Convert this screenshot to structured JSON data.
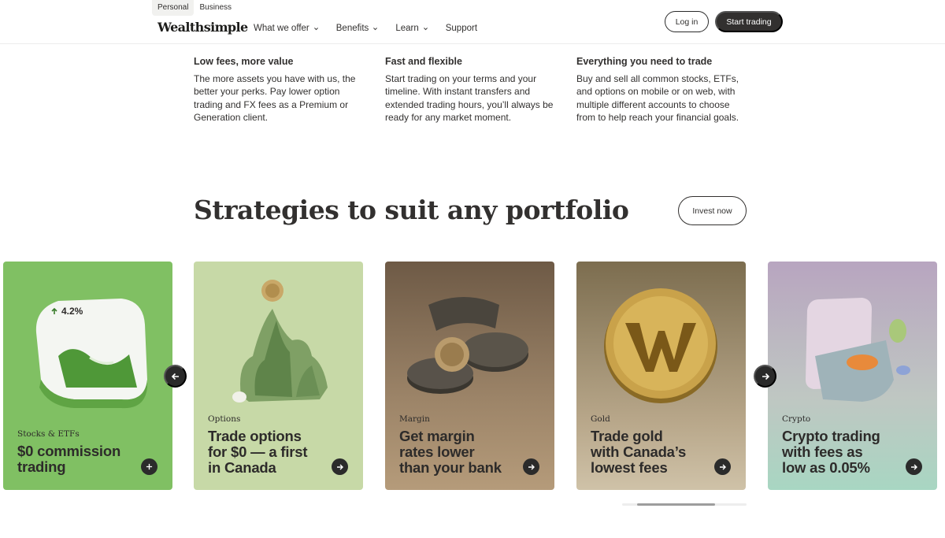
{
  "header": {
    "segments": [
      "Personal",
      "Business"
    ],
    "logo": "Wealthsimple",
    "nav": [
      {
        "label": "What we offer",
        "dropdown": true
      },
      {
        "label": "Benefits",
        "dropdown": true
      },
      {
        "label": "Learn",
        "dropdown": true
      },
      {
        "label": "Support",
        "dropdown": false
      }
    ],
    "login": "Log in",
    "start": "Start trading"
  },
  "features": [
    {
      "title": "Low fees, more value",
      "lines": [
        "The more assets you have with us, the",
        "better your perks. Pay lower option",
        "trading and FX fees as a Premium or",
        "Generation client."
      ]
    },
    {
      "title": "Fast and flexible",
      "lines": [
        "Start trading on your terms and your",
        "timeline. With instant transfers and",
        "extended trading hours, you’ll always be",
        "ready for any market moment."
      ]
    },
    {
      "title": "Everything you need to trade",
      "lines": [
        "Buy and sell all common stocks, ETFs,",
        "and options on mobile or on web, with",
        "multiple different accounts to choose",
        "from to help reach your financial goals."
      ]
    }
  ],
  "strategies": {
    "title": "Strategies to suit any portfolio",
    "invest_button": "Invest now",
    "badge": "4.2%",
    "cards": [
      {
        "category": "Stocks & ETFs",
        "headline": [
          "$0 commission",
          "trading"
        ],
        "action_icon": "plus-icon"
      },
      {
        "category": "Options",
        "headline": [
          "Trade options",
          "for $0 — a first",
          "in Canada"
        ],
        "action_icon": "arrow-right-icon"
      },
      {
        "category": "Margin",
        "headline": [
          "Get margin",
          "rates lower",
          "than your bank"
        ],
        "action_icon": "arrow-right-icon"
      },
      {
        "category": "Gold",
        "headline": [
          "Trade gold",
          "with Canada’s",
          "lowest fees"
        ],
        "action_icon": "arrow-right-icon"
      },
      {
        "category": "Crypto",
        "headline": [
          "Crypto trading",
          "with fees as",
          "low as 0.05%"
        ],
        "action_icon": "arrow-right-icon"
      }
    ],
    "scroll_progress": 0.25
  },
  "colors": {
    "text": "#32302f",
    "dark_button": "#32302f",
    "stocks_card": "#80c063",
    "options_card": "#c7d9a7",
    "margin_card": "#9c8468",
    "gold_card": "#b8a78a",
    "crypto_card": "#b8a5c0"
  }
}
